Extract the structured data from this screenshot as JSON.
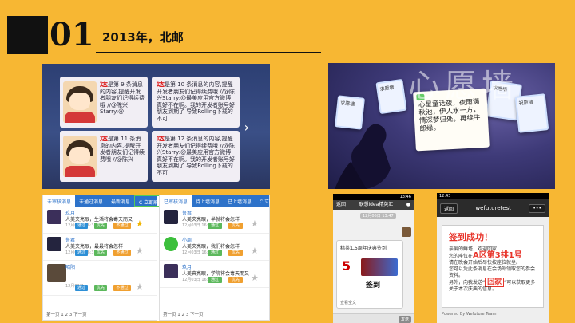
{
  "header": {
    "number": "01",
    "title": "2013年，北邮"
  },
  "wall": {
    "cards": [
      {
        "seal": "送",
        "text": "是第 9 条消息的内容,提醒开发者朋友们记得续费哦 //@陈兴Starry:@"
      },
      {
        "seal": "送",
        "text": "是第 10 条消息的内容,提醒开发者朋友们记得续费哦 //@陈兴Starry:@最美应用官方微博 真好不在啊。我的开发者账号好朋友到期了 导致Rolling下载的不可"
      },
      {
        "seal": "送",
        "text": "是第 11 条消息的内容,提醒开发者朋友们记得续费哦 //@陈兴"
      },
      {
        "seal": "送",
        "text": "是第 12 条消息的内容,提醒开发者朋友们记得续费哦 //@陈兴Starry:@最美应用官方微博 真好不在啊。我的开发者账号好朋友到期了 导致Rolling下载的不可"
      }
    ],
    "arrow": "›"
  },
  "moon": {
    "banner": "心愿墙",
    "note": "心星童话夜，夜雨满秋池，伊人水一方，情深梦归处，再续牛郎缘。",
    "small_cards": [
      "求愿墙",
      "求愿墙",
      "求愿墙",
      "祝愿墙"
    ]
  },
  "web": {
    "left_tabs": [
      "未审核消息",
      "未通过消息",
      "最新消息"
    ],
    "left_refresh": "C 立即刷新",
    "right_tabs": [
      "已审核消息",
      "待上墙消息",
      "已上墙消息"
    ],
    "right_refresh": "C 立即刷新",
    "left_rows": [
      {
        "name": "玖月",
        "msg": "人美夹亮眼，生活将会毒天而又",
        "time": "12月03日 16:33",
        "buttons": [
          "通过",
          "优先",
          "不通过"
        ],
        "star": true
      },
      {
        "name": "鲁君",
        "msg": "人美夹亮眼，最最将会怎样",
        "time": "12月03日 16:32",
        "buttons": [
          "通过",
          "优先",
          "不通过"
        ],
        "star": false
      },
      {
        "name": "昭阳",
        "msg": "",
        "time": "12月03日",
        "buttons": [
          "通过",
          "优先",
          "不通过"
        ],
        "star": false
      }
    ],
    "right_rows": [
      {
        "name": "鲁君",
        "msg": "人美夹亮眼，半就将会怎样",
        "time": "12月03日 16:33",
        "buttons": [
          "通过",
          "优先"
        ],
        "star": false
      },
      {
        "name": "小周",
        "msg": "人美夹亮眼，我们将会怎样",
        "time": "12月03日 16:32",
        "buttons": [
          "通过",
          "优先"
        ],
        "star": false
      },
      {
        "name": "玖月",
        "msg": "人美夹亮眼，学院将会毒天而又",
        "time": "12月03日 16:31",
        "buttons": [
          "通过",
          "优先"
        ],
        "star": false
      }
    ],
    "left_pager": "第一页 1 2 3 下一页",
    "right_pager": "第一页 1 2 3 下一页"
  },
  "phone1": {
    "status": "13:46",
    "back": "返回",
    "title": "联想idea精英汇",
    "chat_title": "精英汇5周年庆典签到",
    "chat_time": "12月06日 13:47",
    "logo_num": "5",
    "sign": "签到",
    "detail": "查看全文",
    "send": "发送"
  },
  "phone2": {
    "status": "12:43",
    "back": "返回",
    "title": "wefuturetest",
    "menu": "•••",
    "heading": "签到成功！",
    "line1": "亲爱的鲜塔，欢迎回家！",
    "line2a": "您的座位在",
    "seat": "A区第3排1号",
    "line3": "请在晚会开始后尽快按座位就坐。",
    "line4": "您可以凭此条消息在会场外领取您的参会资料。",
    "line5a": "另外，向我发送“",
    "reply_word": "回家",
    "line5b": "”可以获取更多关于本次庆典的信息。",
    "footer": "Powered By Wefuture Team"
  }
}
